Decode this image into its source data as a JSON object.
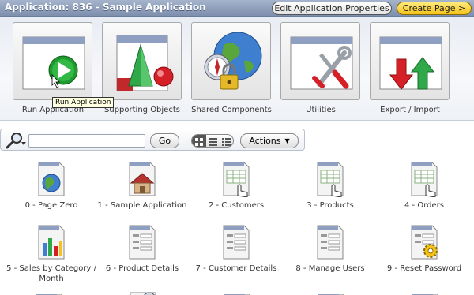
{
  "header": {
    "title": "Application: 836 - Sample Application",
    "edit_button": "Edit Application Properties",
    "create_button": "Create Page >"
  },
  "tiles": [
    {
      "label": "Run Application",
      "icon": "run-play-icon"
    },
    {
      "label": "Supporting Objects",
      "icon": "shapes-icon"
    },
    {
      "label": "Shared Components",
      "icon": "globe-compass-lock-icon"
    },
    {
      "label": "Utilities",
      "icon": "tools-icon"
    },
    {
      "label": "Export / Import",
      "icon": "export-import-arrows-icon"
    }
  ],
  "tooltip": "Run Application",
  "toolbar": {
    "search_placeholder": "",
    "go_label": "Go",
    "actions_label": "Actions"
  },
  "pages": [
    {
      "label": "0 - Page Zero",
      "icon": "globe-page-icon"
    },
    {
      "label": "1 - Sample Application",
      "icon": "home-page-icon"
    },
    {
      "label": "2 - Customers",
      "icon": "report-page-icon"
    },
    {
      "label": "3 - Products",
      "icon": "report-page-icon"
    },
    {
      "label": "4 - Orders",
      "icon": "report-page-icon"
    },
    {
      "label": "5 - Sales by Category / Month",
      "icon": "chart-page-icon"
    },
    {
      "label": "6 - Product Details",
      "icon": "form-page-icon"
    },
    {
      "label": "7 - Customer Details",
      "icon": "form-page-icon"
    },
    {
      "label": "8 - Manage Users",
      "icon": "form-page-icon"
    },
    {
      "label": "9 - Reset Password",
      "icon": "gear-page-icon"
    }
  ]
}
